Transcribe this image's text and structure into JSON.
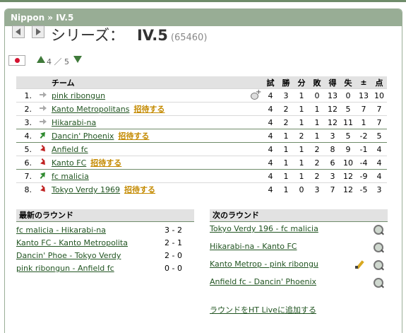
{
  "breadcrumb": "Nippon » IV.5",
  "header": {
    "series_label": "シリーズ：",
    "league_name": "IV.5",
    "league_id": "(65460)",
    "level_text": "4 ／ 5"
  },
  "table": {
    "headers": {
      "team": "チーム",
      "played": "試",
      "won": "勝",
      "drawn": "分",
      "lost": "敗",
      "gf": "得",
      "ga": "失",
      "diff": "±",
      "points": "点"
    },
    "invite_label": "招待する",
    "rows": [
      {
        "pos": "1.",
        "trend": "same",
        "team": "pink ribongun",
        "invite": false,
        "played": "4",
        "won": "3",
        "drawn": "1",
        "lost": "0",
        "gf": "13",
        "ga": "0",
        "diff": "13",
        "points": "10"
      },
      {
        "pos": "2.",
        "trend": "same",
        "team": "Kanto Metropolitans",
        "invite": true,
        "played": "4",
        "won": "2",
        "drawn": "1",
        "lost": "1",
        "gf": "12",
        "ga": "5",
        "diff": "7",
        "points": "7"
      },
      {
        "pos": "3.",
        "trend": "same",
        "team": "Hikarabi-na",
        "invite": false,
        "played": "4",
        "won": "2",
        "drawn": "1",
        "lost": "1",
        "gf": "12",
        "ga": "11",
        "diff": "1",
        "points": "7"
      },
      {
        "pos": "4.",
        "trend": "up",
        "team": "Dancin' Phoenix",
        "invite": true,
        "played": "4",
        "won": "1",
        "drawn": "2",
        "lost": "1",
        "gf": "3",
        "ga": "5",
        "diff": "-2",
        "points": "5"
      },
      {
        "pos": "5.",
        "trend": "down",
        "team": "Anfield fc",
        "invite": false,
        "played": "4",
        "won": "1",
        "drawn": "1",
        "lost": "2",
        "gf": "8",
        "ga": "9",
        "diff": "-1",
        "points": "4"
      },
      {
        "pos": "6.",
        "trend": "down",
        "team": "Kanto FC",
        "invite": true,
        "played": "4",
        "won": "1",
        "drawn": "1",
        "lost": "2",
        "gf": "6",
        "ga": "10",
        "diff": "-4",
        "points": "4"
      },
      {
        "pos": "7.",
        "trend": "up",
        "team": "fc malicia",
        "invite": false,
        "played": "4",
        "won": "1",
        "drawn": "1",
        "lost": "2",
        "gf": "3",
        "ga": "12",
        "diff": "-9",
        "points": "4"
      },
      {
        "pos": "8.",
        "trend": "down",
        "team": "Tokyo Verdy 1969",
        "invite": true,
        "played": "4",
        "won": "1",
        "drawn": "0",
        "lost": "3",
        "gf": "7",
        "ga": "12",
        "diff": "-5",
        "points": "3"
      }
    ]
  },
  "latest_round": {
    "title": "最新のラウンド",
    "matches": [
      {
        "match": "fc malicia - Hikarabi-na",
        "score": "3 - 2"
      },
      {
        "match": "Kanto FC - Kanto Metropolita",
        "score": "2 - 1"
      },
      {
        "match": "Dancin' Phoe - Tokyo Verdy",
        "score": "2 - 0"
      },
      {
        "match": "pink ribongun - Anfield fc",
        "score": "0 - 0"
      }
    ]
  },
  "next_round": {
    "title": "次のラウンド",
    "matches": [
      {
        "match": "Tokyo Verdy 196 - fc malicia"
      },
      {
        "match": "Hikarabi-na - Kanto FC"
      },
      {
        "match": "Kanto Metrop - pink ribongu"
      },
      {
        "match": "Anfield fc - Dancin' Phoenix"
      }
    ],
    "add_live_label": "ラウンドをHT Liveに追加する"
  }
}
